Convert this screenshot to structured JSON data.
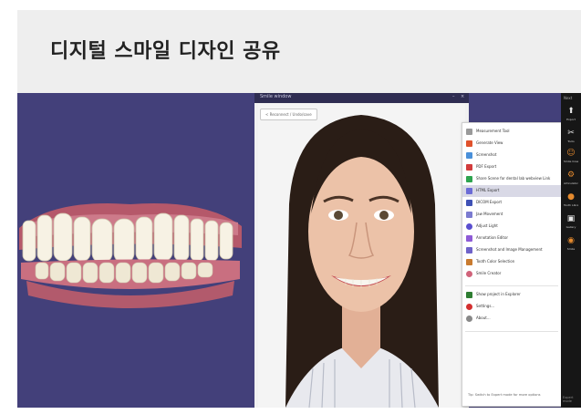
{
  "page": {
    "title": "디지털 스마일 디자인 공유"
  },
  "smile_window": {
    "title": "Smile window",
    "back_button": "< Reconnect / Undo/save"
  },
  "context_menu": {
    "items": [
      {
        "label": "Measurement Tool",
        "icon": "ruler-icon",
        "color": "#9a9a9a"
      },
      {
        "label": "Generate View",
        "icon": "tooth-icon",
        "color": "#e0522c"
      },
      {
        "label": "Screenshot",
        "icon": "camera-icon",
        "color": "#4a90d9"
      },
      {
        "label": "PDF Export",
        "icon": "pdf-icon",
        "color": "#d23c3c"
      },
      {
        "label": "Share Scene for dental lab webview Link",
        "icon": "share-icon",
        "color": "#2ea44f"
      },
      {
        "label": "HTML Export",
        "icon": "html-icon",
        "color": "#6b6bd6",
        "highlighted": true
      },
      {
        "label": "DICOM Export",
        "icon": "dicom-icon",
        "color": "#3f51b5"
      },
      {
        "label": "Jaw Movement",
        "icon": "jaw-icon",
        "color": "#7b7bd0"
      },
      {
        "label": "Adjust Light",
        "icon": "light-icon",
        "color": "#5a4fcf"
      },
      {
        "label": "Annotation Editor",
        "icon": "annotation-icon",
        "color": "#8e5bd6"
      },
      {
        "label": "Screenshot and Image Management",
        "icon": "image-icon",
        "color": "#6f63c9"
      },
      {
        "label": "Tooth Color Selection",
        "icon": "color-icon",
        "color": "#c97b2f"
      },
      {
        "label": "Smile Creator",
        "icon": "smile-icon",
        "color": "#d0637a"
      },
      {
        "label": "Show project in Explorer",
        "icon": "folder-icon",
        "color": "#2e7d32"
      },
      {
        "label": "Settings...",
        "icon": "gear-icon",
        "color": "#d32f2f"
      },
      {
        "label": "About...",
        "icon": "info-icon",
        "color": "#888888"
      }
    ],
    "footer": "Tip: Switch to Expert mode for more options"
  },
  "toolbar": {
    "top_label": "Next",
    "bottom_label": "Expert mode",
    "buttons": [
      {
        "label": "Export",
        "icon": "export-icon",
        "color": "#e8e8e8"
      },
      {
        "label": "Tools",
        "icon": "tools-icon",
        "color": "#e8e8e8"
      },
      {
        "label": "Smile Creator",
        "icon": "smile-creator-icon",
        "color": "#e58a2e"
      },
      {
        "label": "Articulator",
        "icon": "articulator-icon",
        "color": "#e58a2e"
      },
      {
        "label": "Tooth Library",
        "icon": "tooth-library-icon",
        "color": "#e58a2e"
      },
      {
        "label": "Gallery",
        "icon": "gallery-icon",
        "color": "#e8e8e8"
      },
      {
        "label": "Smile",
        "icon": "smile-design-icon",
        "color": "#e58a2e"
      }
    ]
  }
}
